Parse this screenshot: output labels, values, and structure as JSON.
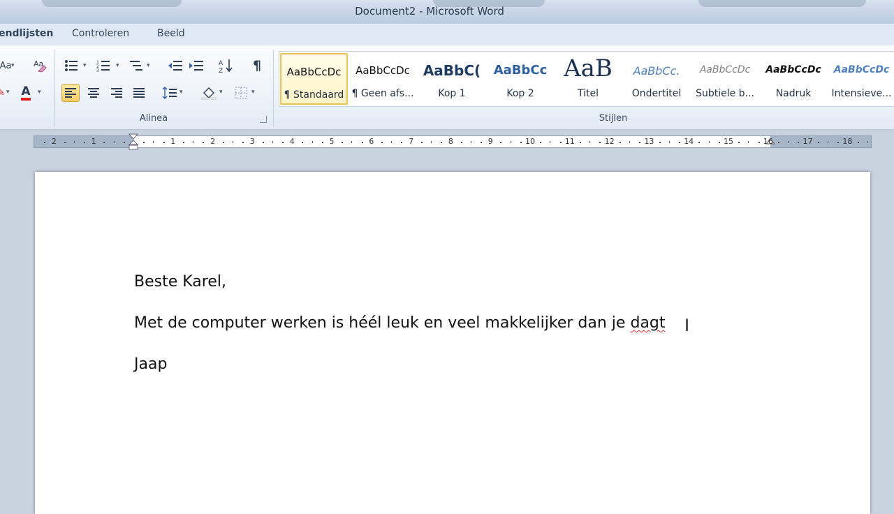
{
  "window": {
    "title": "Document2 - Microsoft Word"
  },
  "tabs": [
    "endlijsten",
    "Controleren",
    "Beeld"
  ],
  "ribbon": {
    "groups": {
      "paragraph": "Alinea",
      "styles": "Stijlen"
    },
    "paragraph_buttons": [
      "bullets",
      "numbering",
      "multilevel-list",
      "decrease-indent",
      "increase-indent",
      "sort",
      "show-formatting",
      "align-left",
      "align-center",
      "align-right",
      "justify",
      "line-spacing",
      "shading",
      "borders"
    ],
    "font_partial": {
      "case_label": "Aa",
      "font_color_label": "A",
      "font_color": "#e02020"
    },
    "styles": [
      {
        "sample": "AaBbCcDc",
        "name": "¶ Standaard"
      },
      {
        "sample": "AaBbCcDc",
        "name": "¶ Geen afs..."
      },
      {
        "sample": "AaBbC(",
        "name": "Kop 1"
      },
      {
        "sample": "AaBbCc",
        "name": "Kop 2"
      },
      {
        "sample": "AaB",
        "name": "Titel"
      },
      {
        "sample": "AaBbCc.",
        "name": "Ondertitel"
      },
      {
        "sample": "AaBbCcDc",
        "name": "Subtiele b..."
      },
      {
        "sample": "AaBbCcDc",
        "name": "Nadruk"
      },
      {
        "sample": "AaBbCcDc",
        "name": "Intensieve..."
      }
    ]
  },
  "ruler": {
    "numbers": [
      "2",
      "1",
      "1",
      "2",
      "3",
      "4",
      "5",
      "6",
      "7",
      "8",
      "9",
      "10",
      "11",
      "12",
      "13",
      "14",
      "15",
      "16",
      "17",
      "18"
    ]
  },
  "document": {
    "paragraphs": [
      "Beste Karel,",
      "Met de computer werken is héél leuk en veel makkelijker dan je ",
      "Jaap"
    ],
    "misspelled_word": "dagt",
    "cursor": "I"
  },
  "colors": {
    "accent_selected": "#f8cc65",
    "spell_error": "#e03030"
  }
}
